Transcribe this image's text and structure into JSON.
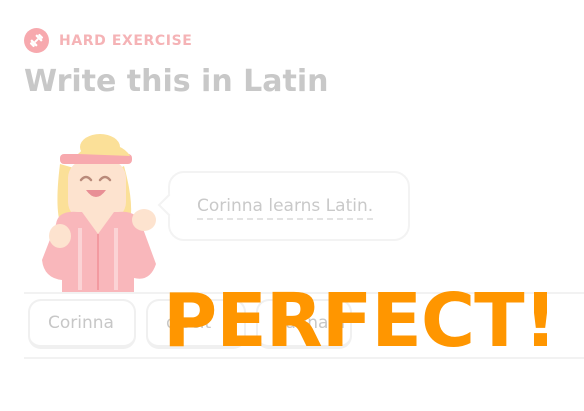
{
  "header": {
    "tag_icon": "dumbbell-icon",
    "tag_label": "HARD EXERCISE",
    "title": "Write this in Latin"
  },
  "speech_bubble": {
    "text": "Corinna learns Latin."
  },
  "word_bank": {
    "tiles": [
      "Corinna",
      "discit",
      "Latinam"
    ]
  },
  "overlay": {
    "text": "PERFECT!"
  },
  "colors": {
    "accent_tag": "#f7a9ae",
    "overlay": "#ff9600",
    "muted_text": "#c8c8c8"
  }
}
